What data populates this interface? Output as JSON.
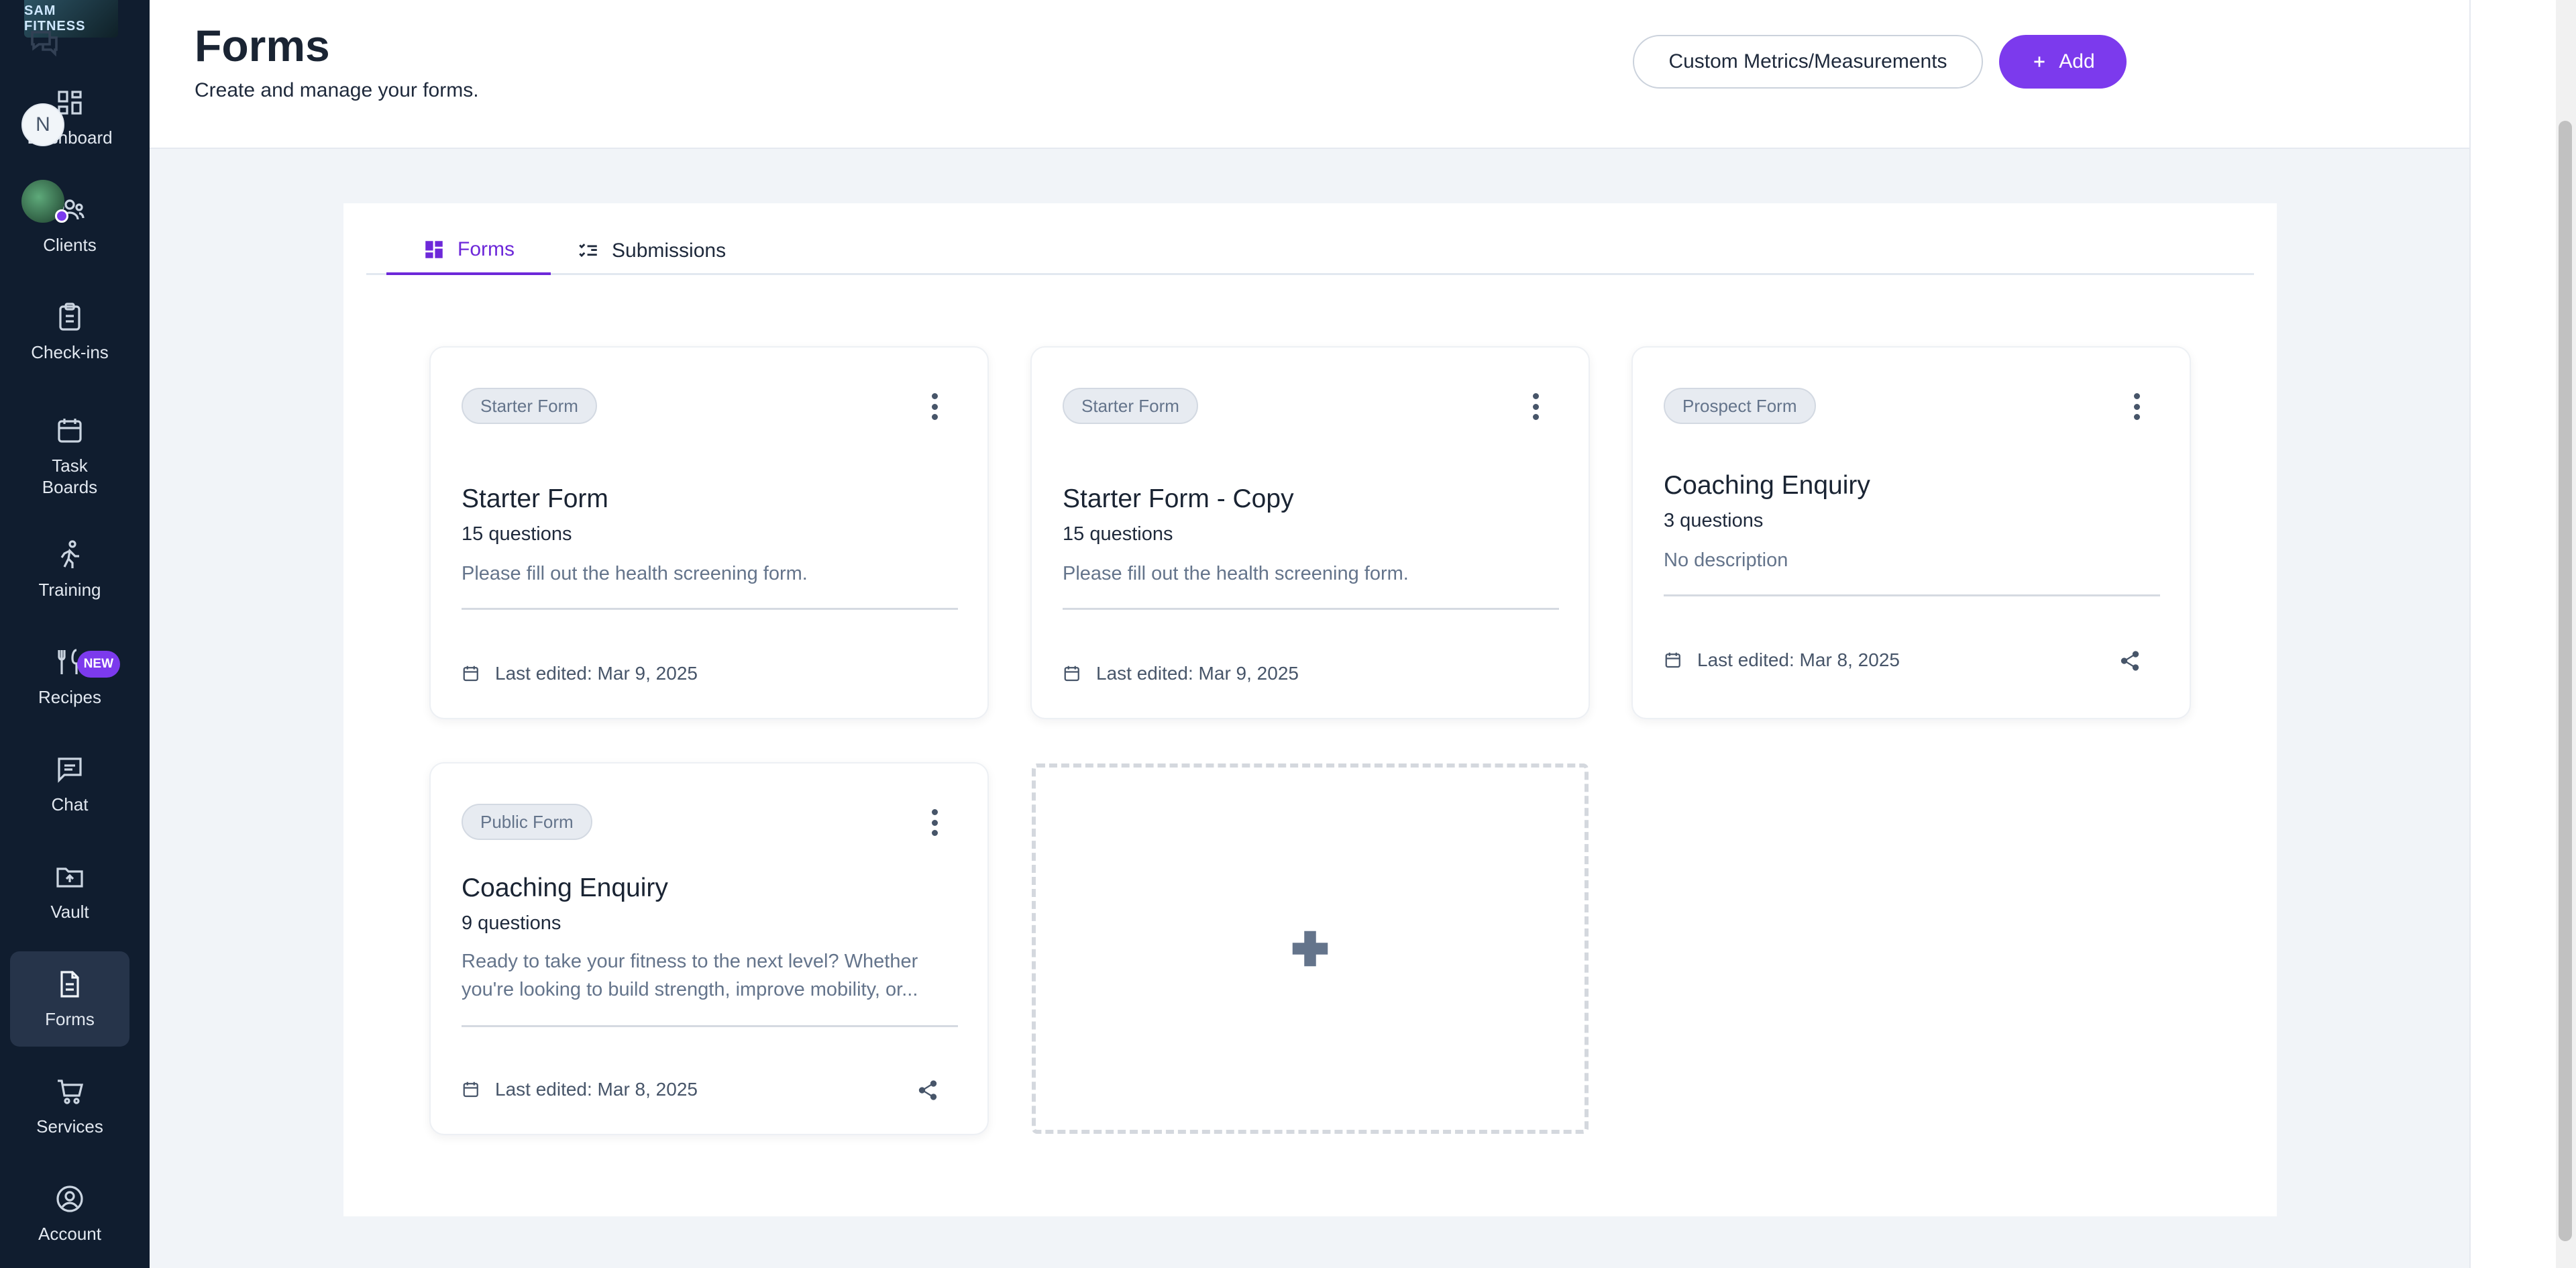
{
  "app": {
    "logo_text": "SAM FITNESS"
  },
  "sidebar": {
    "items": [
      {
        "label": "Dashboard",
        "icon": "dashboard-icon"
      },
      {
        "label": "Clients",
        "icon": "users-icon"
      },
      {
        "label": "Check-ins",
        "icon": "clipboard-icon"
      },
      {
        "label": "Task\nBoards",
        "icon": "calendar-icon"
      },
      {
        "label": "Training",
        "icon": "running-icon"
      },
      {
        "label": "Recipes",
        "icon": "utensils-icon",
        "badge": "NEW"
      },
      {
        "label": "Chat",
        "icon": "chat-icon"
      },
      {
        "label": "Vault",
        "icon": "folder-upload-icon"
      },
      {
        "label": "Forms",
        "icon": "document-icon",
        "active": true
      },
      {
        "label": "Services",
        "icon": "cart-icon"
      },
      {
        "label": "Account",
        "icon": "user-circle-icon"
      }
    ]
  },
  "header": {
    "title": "Forms",
    "subtitle": "Create and manage your forms.",
    "custom_metrics_label": "Custom Metrics/Measurements",
    "add_label": "Add"
  },
  "rail": {
    "avatar_initial": "N"
  },
  "tabs": [
    {
      "label": "Forms",
      "active": true
    },
    {
      "label": "Submissions",
      "active": false
    }
  ],
  "cards": [
    {
      "tag": "Starter Form",
      "title": "Starter Form",
      "questions": "15 questions",
      "description": "Please fill out the health screening form.",
      "last_edited": "Last edited: Mar 9, 2025",
      "shareable": false
    },
    {
      "tag": "Starter Form",
      "title": "Starter Form - Copy",
      "questions": "15 questions",
      "description": "Please fill out the health screening form.",
      "last_edited": "Last edited: Mar 9, 2025",
      "shareable": false
    },
    {
      "tag": "Prospect Form",
      "title": "Coaching Enquiry",
      "questions": "3 questions",
      "description": "No description",
      "last_edited": "Last edited: Mar 8, 2025",
      "shareable": true
    },
    {
      "tag": "Public Form",
      "title": "Coaching Enquiry",
      "questions": "9 questions",
      "description": "Ready to take your fitness to the next level? Whether you're looking to build strength, improve mobility, or...",
      "last_edited": "Last edited: Mar 8, 2025",
      "shareable": true
    }
  ],
  "colors": {
    "sidebar_bg": "#101d2f",
    "accent": "#7c3aed",
    "page_bg": "#f1f4f8"
  }
}
